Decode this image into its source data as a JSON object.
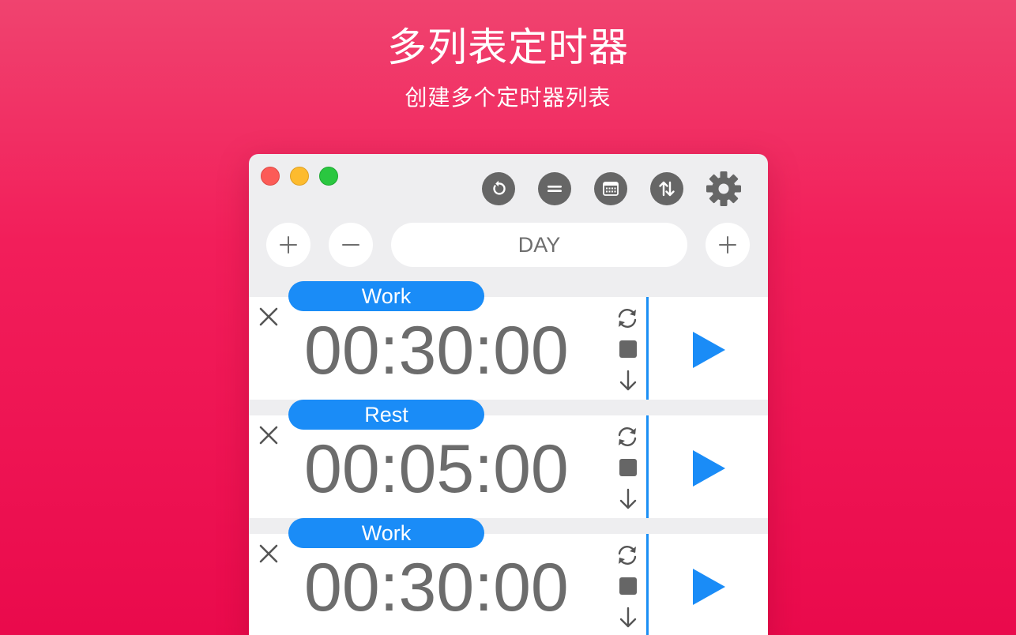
{
  "promo": {
    "title": "多列表定时器",
    "subtitle": "创建多个定时器列表"
  },
  "toolbar": {
    "buttons": [
      "reset-icon",
      "list-icon",
      "calendar-icon",
      "sort-icon",
      "gear-icon"
    ]
  },
  "list_bar": {
    "add_left": "+",
    "remove": "−",
    "list_name": "DAY",
    "add_right": "+"
  },
  "timers": [
    {
      "label": "Work",
      "time": "00:30:00"
    },
    {
      "label": "Rest",
      "time": "00:05:00"
    },
    {
      "label": "Work",
      "time": "00:30:00"
    }
  ],
  "colors": {
    "accent": "#1a8cf7",
    "background": "#f21e5a",
    "icon": "#666666"
  }
}
